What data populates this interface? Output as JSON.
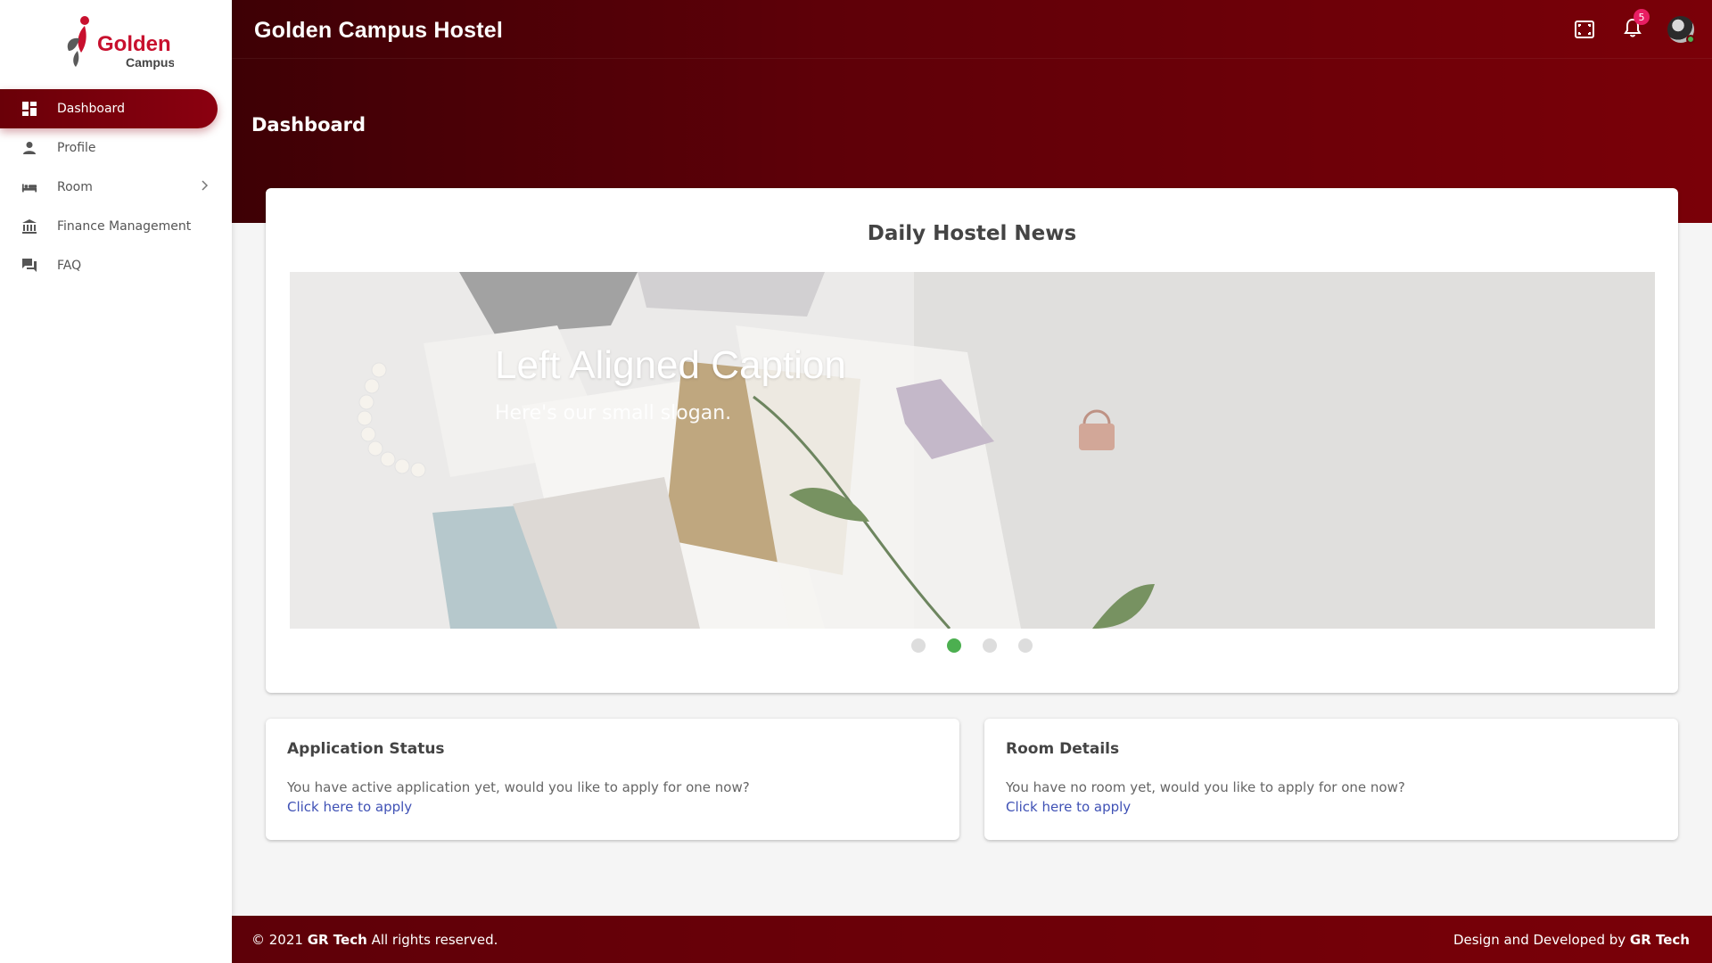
{
  "app": {
    "title": "Golden Campus Hostel"
  },
  "logo": {
    "line1": "Golden",
    "line2": "Campus"
  },
  "sidebar": {
    "items": [
      {
        "label": "Dashboard",
        "icon": "dashboard-icon",
        "active": true
      },
      {
        "label": "Profile",
        "icon": "person-icon"
      },
      {
        "label": "Room",
        "icon": "bed-icon",
        "has_submenu": true
      },
      {
        "label": "Finance Management",
        "icon": "bank-icon"
      },
      {
        "label": "FAQ",
        "icon": "forum-icon"
      }
    ]
  },
  "topbar": {
    "notification_count": "5",
    "icons": [
      "fullscreen-icon",
      "bell-icon",
      "avatar"
    ]
  },
  "page": {
    "title": "Dashboard"
  },
  "news": {
    "title": "Daily Hostel News",
    "slide": {
      "caption": "Left Aligned Caption",
      "subcaption": "Here's our small slogan."
    },
    "indicator_count": 4,
    "active_indicator": 2
  },
  "application_status": {
    "title": "Application Status",
    "text": "You have active application yet, would you like to apply for one now?",
    "link": "Click here to apply"
  },
  "room_details": {
    "title": "Room Details",
    "text": "You have no room yet, would you like to apply for one now?",
    "link": "Click here to apply"
  },
  "footer": {
    "copyright_prefix": "© 2021 ",
    "brand": "GR Tech",
    "copyright_suffix": " All rights reserved.",
    "credit_prefix": "Design and Developed by ",
    "credit_brand": "GR Tech"
  },
  "colors": {
    "primary": "#7a0008",
    "primary_dark": "#3e0005",
    "indicator_active": "#4caf50",
    "badge": "#e91e63",
    "link": "#3f51b5"
  }
}
